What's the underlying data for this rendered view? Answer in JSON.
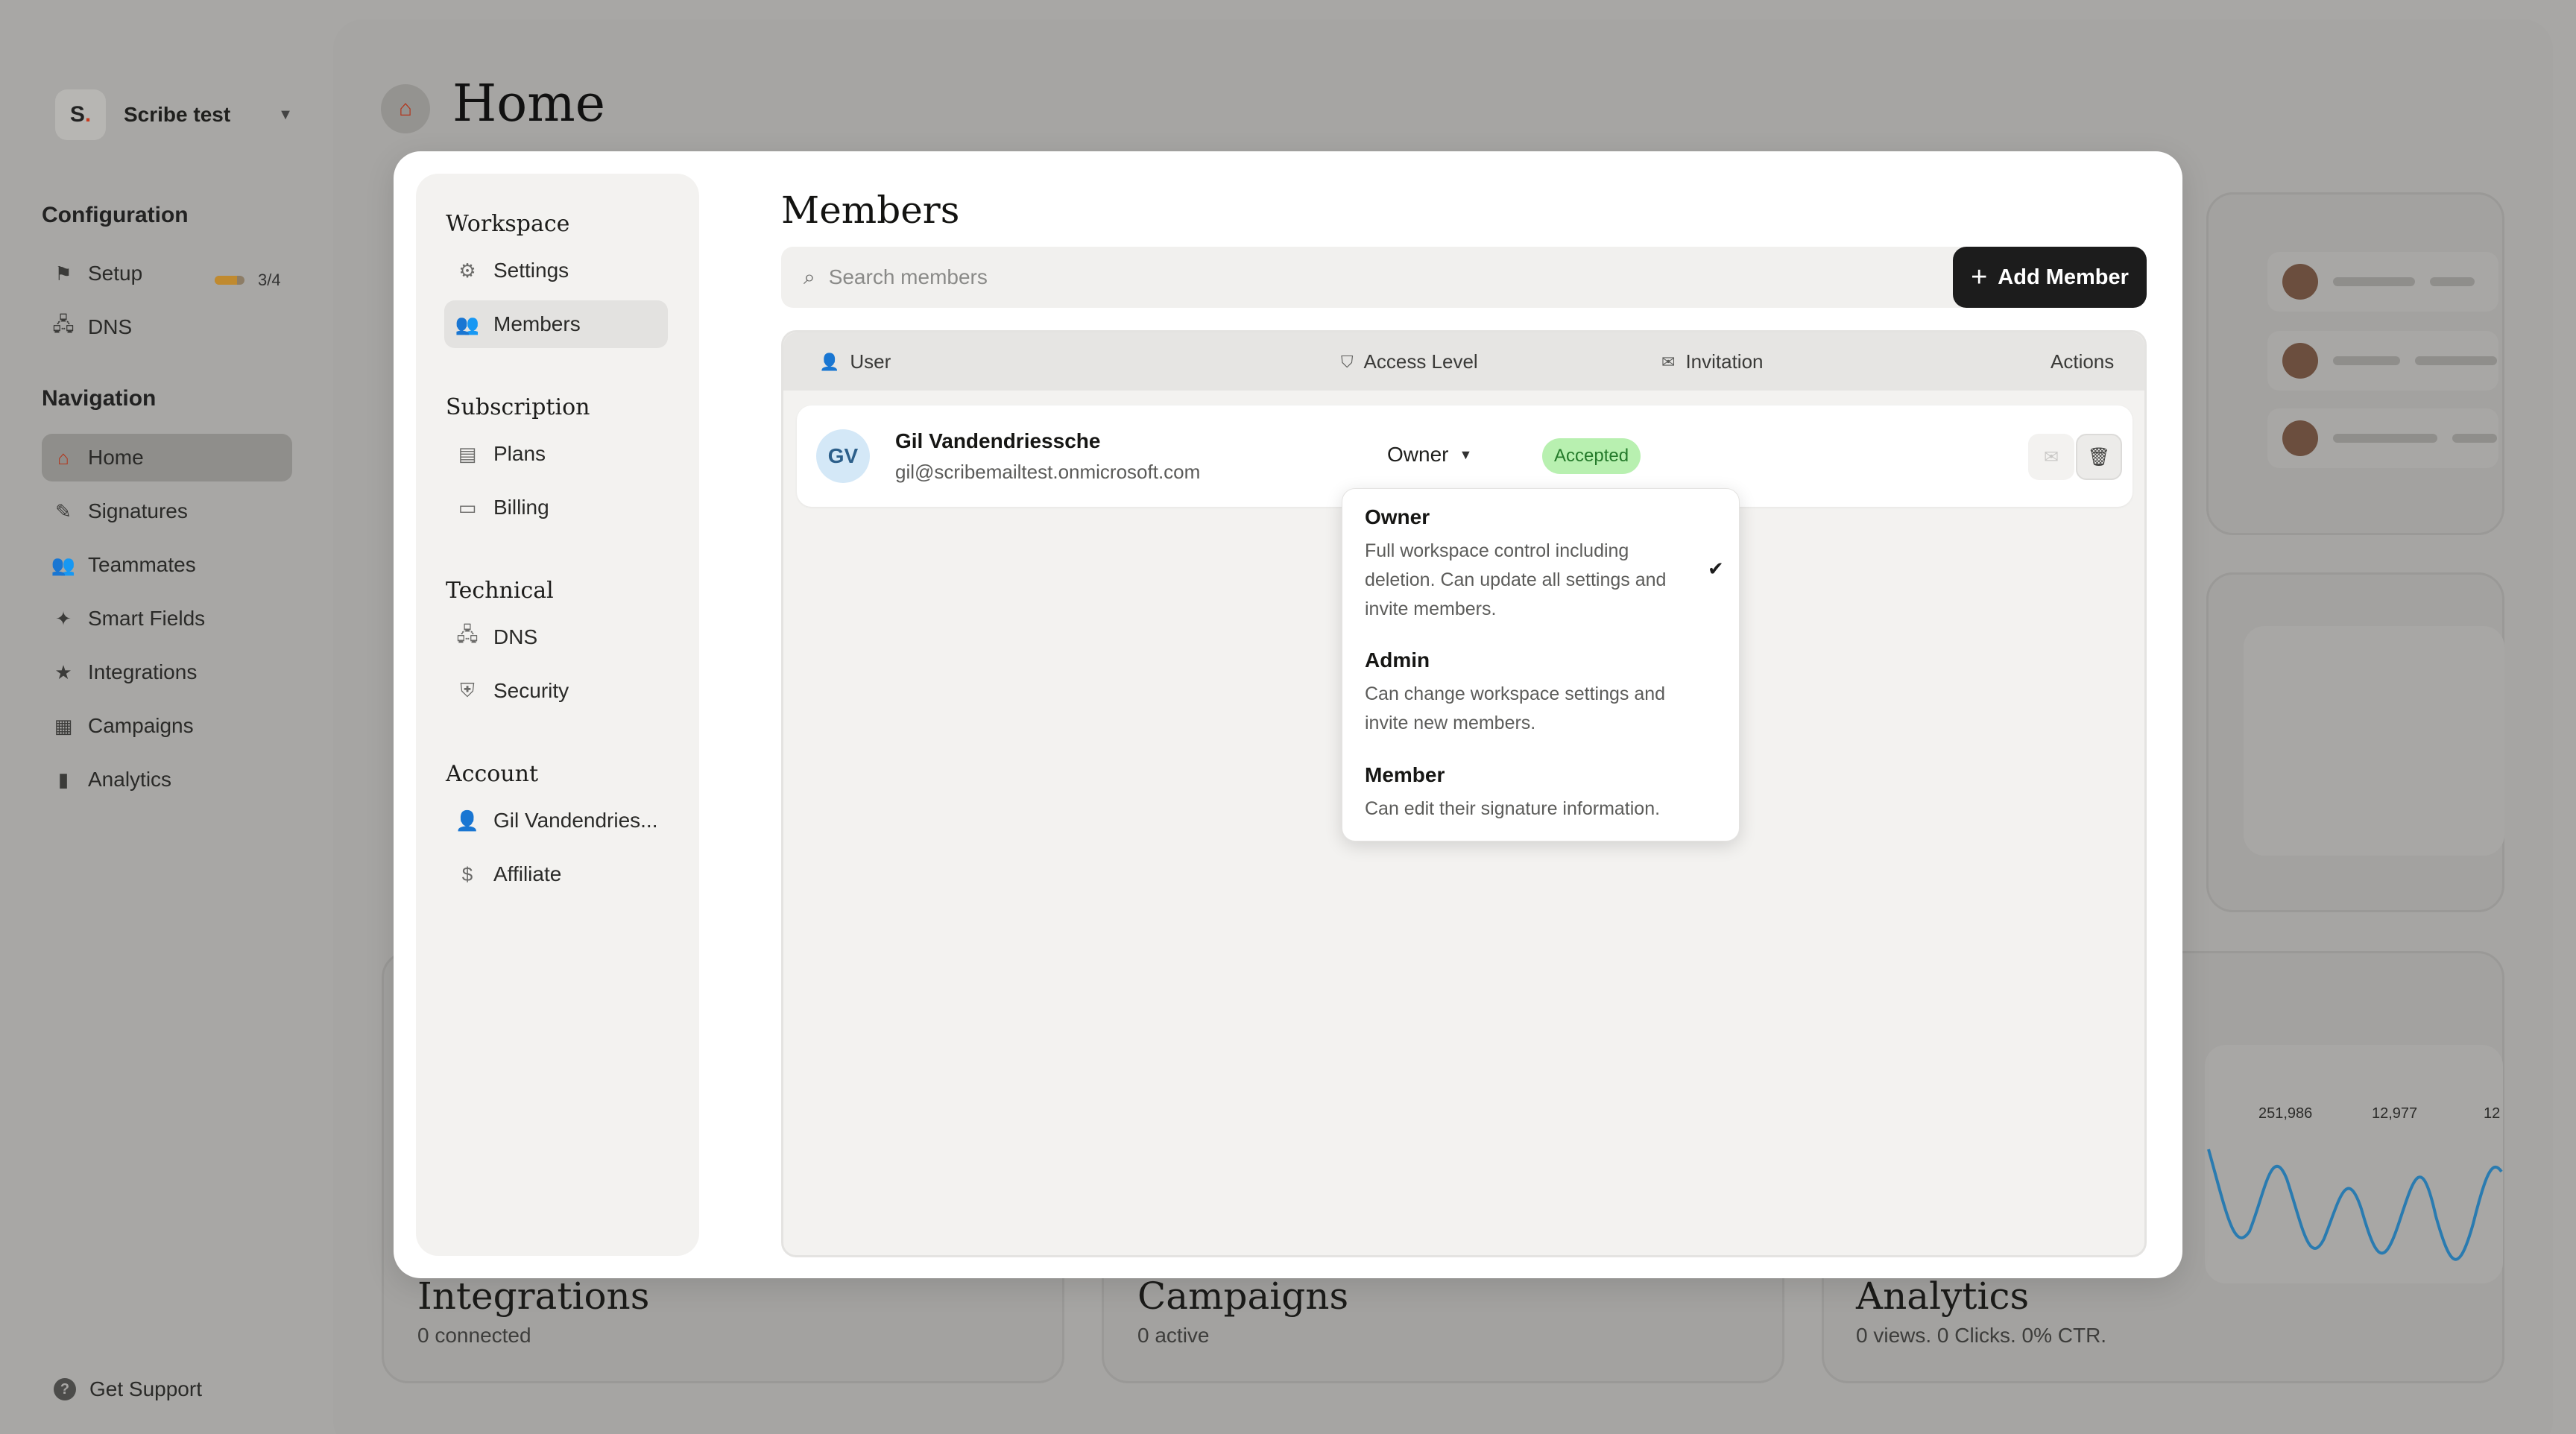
{
  "workspace": {
    "logo": "S",
    "logo_dot": ".",
    "name": "Scribe test"
  },
  "sidebar": {
    "configuration_title": "Configuration",
    "config_items": [
      {
        "label": "Setup",
        "icon": "flag-icon",
        "progress_text": "3/4",
        "progress": 0.75
      },
      {
        "label": "DNS",
        "icon": "dns-icon"
      }
    ],
    "navigation_title": "Navigation",
    "nav_items": [
      {
        "label": "Home",
        "icon": "home-icon",
        "active": true
      },
      {
        "label": "Signatures",
        "icon": "pen-icon"
      },
      {
        "label": "Teammates",
        "icon": "users-icon"
      },
      {
        "label": "Smart Fields",
        "icon": "wand-icon"
      },
      {
        "label": "Integrations",
        "icon": "star-icon"
      },
      {
        "label": "Campaigns",
        "icon": "calendar-icon"
      },
      {
        "label": "Analytics",
        "icon": "chart-icon"
      }
    ],
    "support_label": "Get Support"
  },
  "page": {
    "title": "Home"
  },
  "background_cards": {
    "integrations": {
      "title": "Integrations",
      "sub": "0 connected"
    },
    "campaigns": {
      "title": "Campaigns",
      "sub": "0 active"
    },
    "analytics": {
      "title": "Analytics",
      "sub": "0 views. 0 Clicks. 0% CTR.",
      "stats": [
        "251,986",
        "12,977",
        "12"
      ]
    }
  },
  "modal": {
    "nav": {
      "sections": [
        {
          "title": "Workspace",
          "items": [
            {
              "label": "Settings",
              "icon": "gear-icon"
            },
            {
              "label": "Members",
              "icon": "members-icon",
              "active": true
            }
          ]
        },
        {
          "title": "Subscription",
          "items": [
            {
              "label": "Plans",
              "icon": "document-icon"
            },
            {
              "label": "Billing",
              "icon": "billing-icon"
            }
          ]
        },
        {
          "title": "Technical",
          "items": [
            {
              "label": "DNS",
              "icon": "dns-icon"
            },
            {
              "label": "Security",
              "icon": "shield-icon"
            }
          ]
        },
        {
          "title": "Account",
          "items": [
            {
              "label": "Gil Vandendries...",
              "icon": "user-icon"
            },
            {
              "label": "Affiliate",
              "icon": "affiliate-icon"
            }
          ]
        }
      ]
    },
    "title": "Members",
    "search_placeholder": "Search members",
    "add_member_label": "Add Member",
    "table": {
      "headers": {
        "user": "User",
        "access": "Access Level",
        "invitation": "Invitation",
        "actions": "Actions"
      },
      "rows": [
        {
          "initials": "GV",
          "name": "Gil Vandendriessche",
          "email": "gil@scribemailtest.onmicrosoft.com",
          "role": "Owner",
          "invitation": "Accepted"
        }
      ]
    },
    "role_dropdown": {
      "options": [
        {
          "title": "Owner",
          "desc": "Full workspace control including deletion. Can update all settings and invite members.",
          "selected": true
        },
        {
          "title": "Admin",
          "desc": "Can change workspace settings and invite new members."
        },
        {
          "title": "Member",
          "desc": "Can edit their signature information."
        }
      ]
    }
  },
  "colors": {
    "accent": "#e2542c",
    "badge_bg": "#b8f0b0",
    "badge_text": "#247a2a",
    "primary_btn": "#1c1c1c"
  }
}
